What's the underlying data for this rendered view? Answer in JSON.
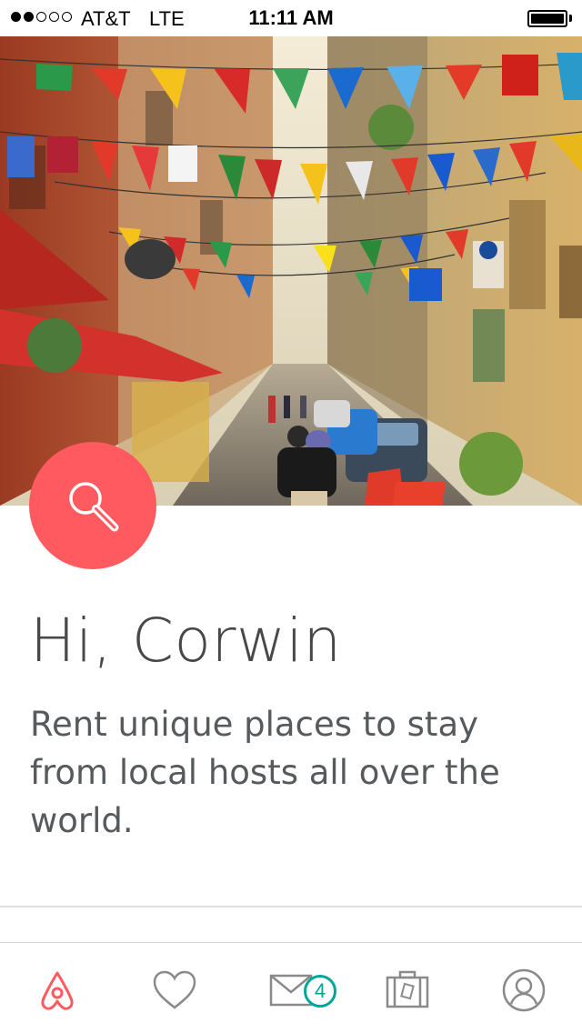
{
  "status_bar": {
    "signal_bars_filled": 2,
    "signal_bars_total": 5,
    "carrier": "AT&T",
    "network": "LTE",
    "time": "11:11 AM",
    "battery_level": 1.0
  },
  "hero": {
    "image_description": "street-with-flags-photo"
  },
  "search_button": {
    "icon": "search-icon",
    "color": "#ff5a5f"
  },
  "greeting": "Hi, Corwin",
  "tagline": "Rent unique places to stay from local hosts all over the world.",
  "tab_bar": {
    "tabs": [
      {
        "name": "explore",
        "icon": "airbnb-logo-icon",
        "active": true
      },
      {
        "name": "wishlists",
        "icon": "heart-icon",
        "active": false
      },
      {
        "name": "inbox",
        "icon": "envelope-icon",
        "active": false
      },
      {
        "name": "trips",
        "icon": "suitcase-icon",
        "active": false
      },
      {
        "name": "profile",
        "icon": "user-icon",
        "active": false
      }
    ],
    "inbox_badge": "4",
    "active_color": "#ff5a5f",
    "inactive_color": "#8a8a8a",
    "badge_color": "#00a699"
  }
}
